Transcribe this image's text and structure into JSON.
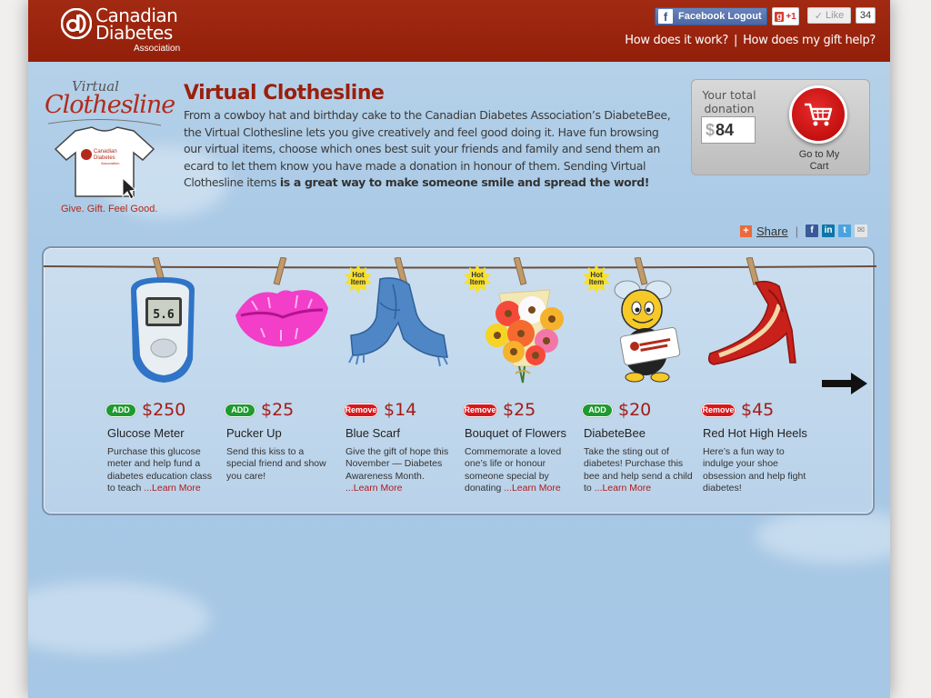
{
  "header": {
    "logo_line1": "Canadian",
    "logo_line2": "Diabetes",
    "logo_line3": "Association",
    "facebook_button": "Facebook Logout",
    "gplus_label": "+1",
    "like_label": "Like",
    "like_count": "34",
    "nav_how_it_works": "How does it work?",
    "nav_separator": "|",
    "nav_how_gift_helps": "How does my gift help?"
  },
  "brand": {
    "script_line1": "Virtual",
    "script_line2": "Clothesline",
    "tshirt_line1": "Canadian",
    "tshirt_line2": "Diabetes",
    "tshirt_line3": "Association",
    "tagline": "Give. Gift. Feel Good."
  },
  "intro": {
    "title": "Virtual Clothesline",
    "text": "From a cowboy hat and birthday cake to the Canadian Diabetes Association’s DiabeteBee, the Virtual Clothesline lets you give creatively and feel good doing it. Have fun browsing our virtual items, choose which ones best suit your friends and family and send them an ecard to let them know you have made a donation in honour of them. Sending Virtual Clothesline items ",
    "text_bold": "is a great way to make someone smile and spread the word!"
  },
  "donation": {
    "label": "Your total donation",
    "currency": "$",
    "value": "84",
    "cart_label": "Go to My Cart"
  },
  "share": {
    "label": "Share",
    "separator": "|"
  },
  "items": [
    {
      "action": "ADD",
      "price": "$250",
      "name": "Glucose Meter",
      "desc": "Purchase this glucose meter and help fund a diabetes education class to teach ",
      "more": "...Learn More",
      "hot": false,
      "display": "5.6"
    },
    {
      "action": "ADD",
      "price": "$25",
      "name": "Pucker Up",
      "desc": "Send this kiss to a special friend and show you care!",
      "more": "",
      "hot": false
    },
    {
      "action": "Remove",
      "price": "$14",
      "name": "Blue Scarf",
      "desc": "Give the gift of hope this November — Diabetes Awareness Month.",
      "more": "...Learn More",
      "hot": true,
      "desc_prefix": ""
    },
    {
      "action": "Remove",
      "price": "$25",
      "name": "Bouquet of Flowers",
      "desc": "Commemorate a loved one’s life or honour someone special by donating ",
      "more": "...Learn More",
      "hot": true
    },
    {
      "action": "ADD",
      "price": "$20",
      "name": "DiabeteBee",
      "desc": "Take the sting out of diabetes! Purchase this bee and help send a child to ",
      "more": "...Learn More",
      "hot": true
    },
    {
      "action": "Remove",
      "price": "$45",
      "name": "Red Hot High Heels",
      "desc": "Here’s a fun way to indulge your shoe obsession and help fight diabetes!",
      "more": "",
      "hot": false
    }
  ],
  "hot_label_line1": "Hot",
  "hot_label_line2": "Item",
  "colors": {
    "header_red": "#931f0a",
    "title_red": "#9a1f0c",
    "add_green": "#1f9a30",
    "remove_red": "#d9181c"
  },
  "icons": [
    "facebook-icon",
    "gplus-icon",
    "like-icon",
    "cart-icon",
    "share-plus-icon",
    "facebook-share-icon",
    "linkedin-icon",
    "twitter-icon",
    "email-icon",
    "next-arrow-icon"
  ]
}
